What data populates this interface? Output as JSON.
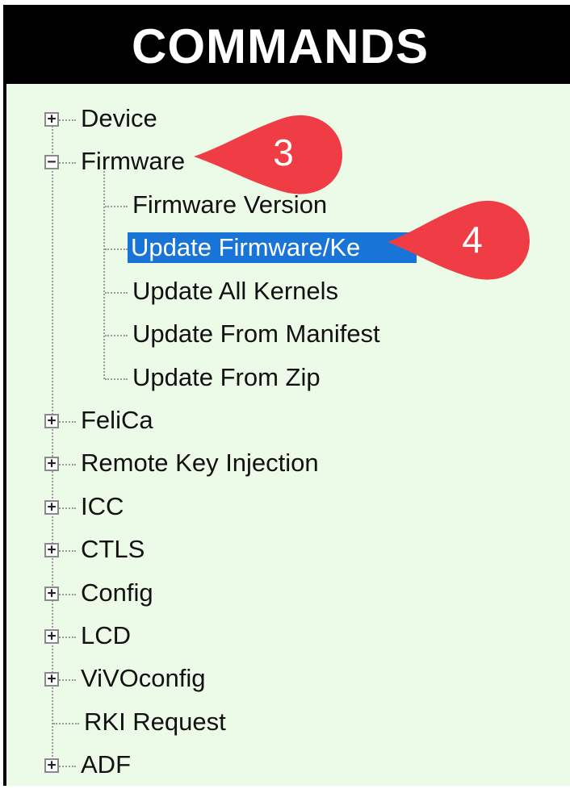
{
  "panel": {
    "title": "COMMANDS"
  },
  "tree": {
    "device": "Device",
    "firmware": "Firmware",
    "firmware_children": [
      "Firmware Version",
      "Update Firmware/Ke",
      "Update All Kernels",
      "Update From Manifest",
      "Update From Zip"
    ],
    "items": [
      "FeliCa",
      "Remote Key Injection",
      "ICC",
      "CTLS",
      "Config",
      "LCD",
      "ViVOconfig",
      "RKI Request",
      "ADF"
    ]
  },
  "callouts": {
    "step3": "3",
    "step4": "4"
  },
  "colors": {
    "panel_bg": "#ebfbe8",
    "selection": "#1874d6",
    "callout": "#f03c45",
    "header_bg": "#000000"
  }
}
